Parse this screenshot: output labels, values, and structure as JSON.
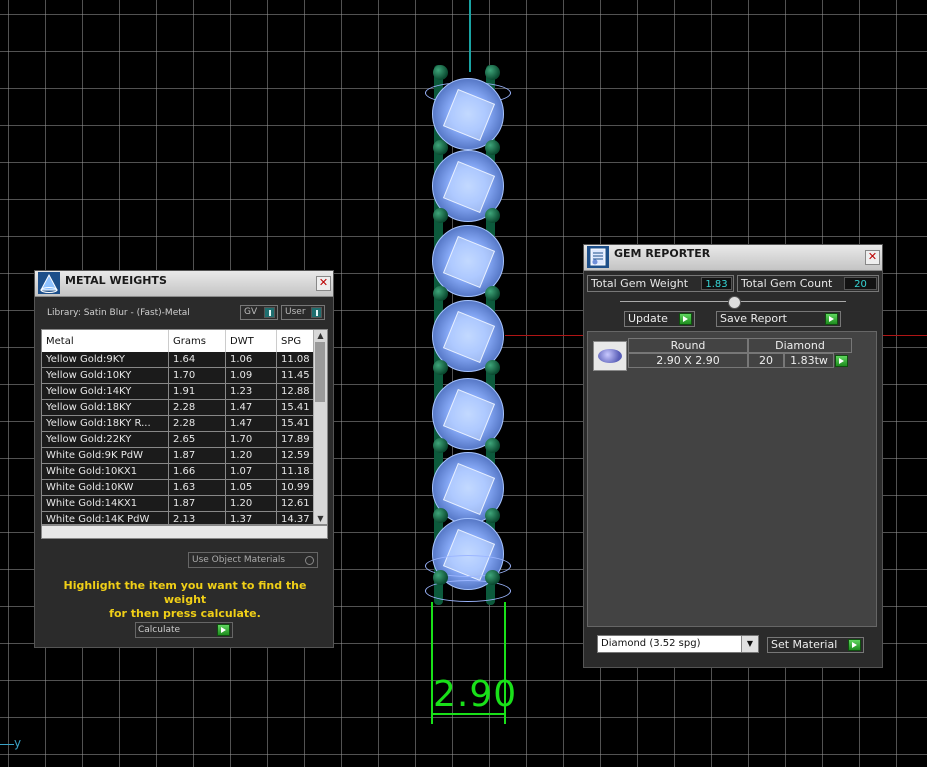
{
  "viewport": {
    "axis_label": "y",
    "dimension_text": "2.90"
  },
  "metal_weights": {
    "title": "METAL WEIGHTS",
    "library_label": "Library: Satin Blur - (Fast)-Metal",
    "gv_label": "GV",
    "user_label": "User",
    "columns": [
      "Metal",
      "Grams",
      "DWT",
      "SPG"
    ],
    "rows": [
      [
        "Yellow Gold:9KY",
        "1.64",
        "1.06",
        "11.08"
      ],
      [
        "Yellow Gold:10KY",
        "1.70",
        "1.09",
        "11.45"
      ],
      [
        "Yellow Gold:14KY",
        "1.91",
        "1.23",
        "12.88"
      ],
      [
        "Yellow Gold:18KY",
        "2.28",
        "1.47",
        "15.41"
      ],
      [
        "Yellow Gold:18KY R...",
        "2.28",
        "1.47",
        "15.41"
      ],
      [
        "Yellow Gold:22KY",
        "2.65",
        "1.70",
        "17.89"
      ],
      [
        "White Gold:9K PdW",
        "1.87",
        "1.20",
        "12.59"
      ],
      [
        "White Gold:10KX1",
        "1.66",
        "1.07",
        "11.18"
      ],
      [
        "White Gold:10KW",
        "1.63",
        "1.05",
        "10.99"
      ],
      [
        "White Gold:14KX1",
        "1.87",
        "1.20",
        "12.61"
      ],
      [
        "White Gold:14K PdW",
        "2.13",
        "1.37",
        "14.37"
      ]
    ],
    "use_object_materials": "Use Object Materials",
    "hint_line1": "Highlight the item you want to find the weight",
    "hint_line2": "for then press calculate.",
    "calculate_label": "Calculate"
  },
  "gem_reporter": {
    "title": "GEM REPORTER",
    "total_weight_label": "Total Gem Weight",
    "total_weight_value": "1.83",
    "total_count_label": "Total Gem Count",
    "total_count_value": "20",
    "update_label": "Update",
    "save_report_label": "Save Report",
    "gem_row": {
      "shape": "Round",
      "size": "2.90 X 2.90",
      "material": "Diamond",
      "count": "20",
      "weight": "1.83tw"
    },
    "material_select": "Diamond    (3.52 spg)",
    "set_material_label": "Set Material"
  },
  "colors": {
    "accent_green": "#19e019",
    "hint_yellow": "#f0cf17",
    "value_cyan": "#36d5d5"
  }
}
